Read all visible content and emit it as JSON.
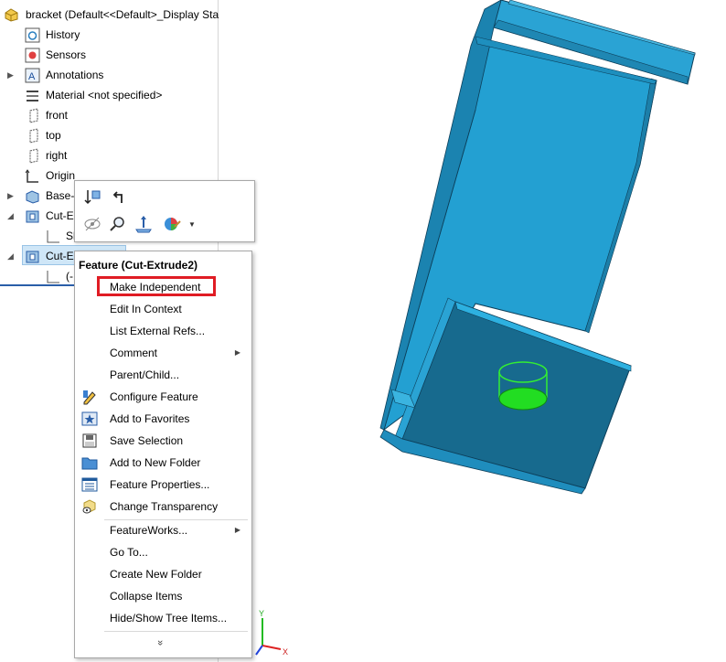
{
  "tree": {
    "root": "bracket  (Default<<Default>_Display Sta",
    "items": [
      {
        "label": "History"
      },
      {
        "label": "Sensors"
      },
      {
        "label": "Annotations"
      },
      {
        "label": "Material <not specified>"
      },
      {
        "label": "front"
      },
      {
        "label": "top"
      },
      {
        "label": "right"
      },
      {
        "label": "Origin"
      },
      {
        "label": "Base-I"
      },
      {
        "label": "Cut-Ex"
      },
      {
        "label": "Sl"
      },
      {
        "label": "Cut-Ex"
      },
      {
        "label": "(-"
      }
    ]
  },
  "context_menu": {
    "title": "Feature (Cut-Extrude2)",
    "items": [
      {
        "label": "Make Independent"
      },
      {
        "label": "Edit In Context"
      },
      {
        "label": "List External Refs..."
      },
      {
        "label": "Comment"
      },
      {
        "label": "Parent/Child..."
      },
      {
        "label": "Configure Feature"
      },
      {
        "label": "Add to Favorites"
      },
      {
        "label": "Save Selection"
      },
      {
        "label": "Add to New Folder"
      },
      {
        "label": "Feature Properties..."
      },
      {
        "label": "Change Transparency"
      },
      {
        "label": "FeatureWorks..."
      },
      {
        "label": "Go To..."
      },
      {
        "label": "Create New Folder"
      },
      {
        "label": "Collapse Items"
      },
      {
        "label": "Hide/Show Tree Items..."
      }
    ],
    "more_glyph": "»"
  },
  "triad": {
    "y_label": "Y",
    "x_label": "X"
  },
  "colors": {
    "model": "#2aa3d4",
    "model_dark": "#1a6f96",
    "highlight": "#e01c24",
    "selection": "#cfe6f7",
    "hole": "#22dd22"
  }
}
